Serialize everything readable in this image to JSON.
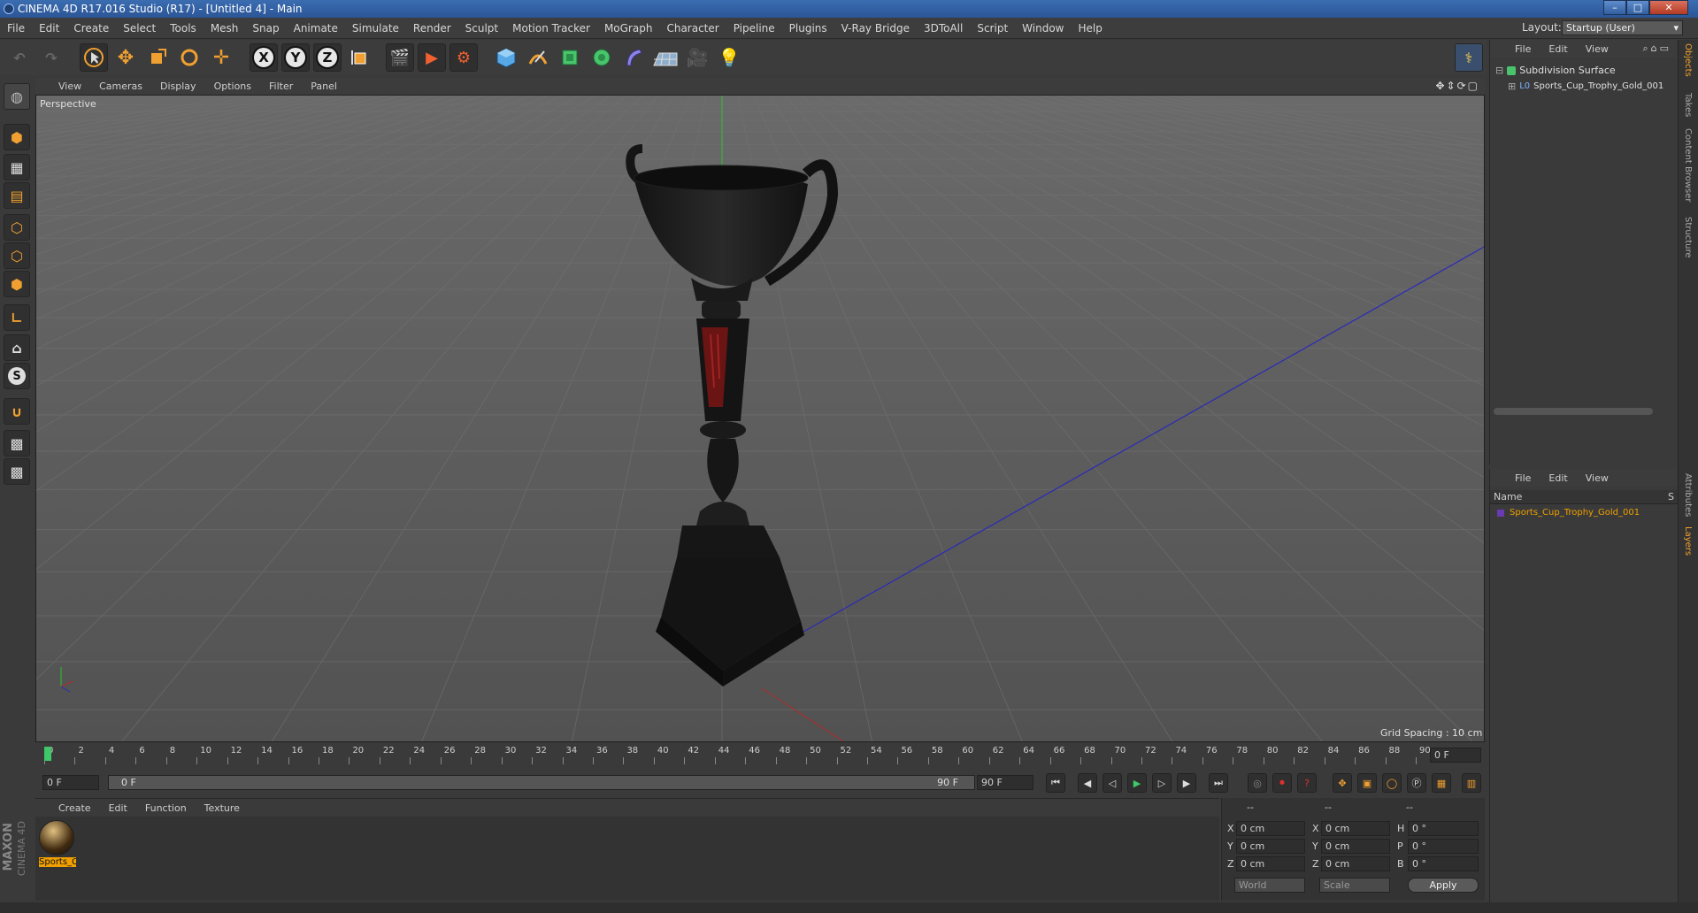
{
  "window": {
    "title": "CINEMA 4D R17.016 Studio (R17) - [Untitled 4] - Main",
    "controls": [
      "–",
      "□",
      "✕"
    ]
  },
  "menubar": [
    "File",
    "Edit",
    "Create",
    "Select",
    "Tools",
    "Mesh",
    "Snap",
    "Animate",
    "Simulate",
    "Render",
    "Sculpt",
    "Motion Tracker",
    "MoGraph",
    "Character",
    "Pipeline",
    "Plugins",
    "V-Ray Bridge",
    "3DToAll",
    "Script",
    "Window",
    "Help"
  ],
  "layout": {
    "label": "Layout:",
    "value": "Startup (User)"
  },
  "toolbar": {
    "axis_x": "X",
    "axis_y": "Y",
    "axis_z": "Z"
  },
  "left_tools": {
    "snap_label": "S"
  },
  "viewport": {
    "menu": [
      "View",
      "Cameras",
      "Display",
      "Options",
      "Filter",
      "Panel"
    ],
    "label": "Perspective",
    "grid_spacing": "Grid Spacing : 10 cm"
  },
  "timeline": {
    "ticks": [
      "0",
      "2",
      "4",
      "6",
      "8",
      "10",
      "12",
      "14",
      "16",
      "18",
      "20",
      "22",
      "24",
      "26",
      "28",
      "30",
      "32",
      "34",
      "36",
      "38",
      "40",
      "42",
      "44",
      "46",
      "48",
      "50",
      "52",
      "54",
      "56",
      "58",
      "60",
      "62",
      "64",
      "66",
      "68",
      "70",
      "72",
      "74",
      "76",
      "78",
      "80",
      "82",
      "84",
      "86",
      "88",
      "90"
    ],
    "current_frame": "0 F"
  },
  "transport": {
    "start_field": "0 F",
    "range_start": "0 F",
    "range_end": "90 F",
    "end_field": "90 F"
  },
  "material_panel": {
    "menu": [
      "Create",
      "Edit",
      "Function",
      "Texture"
    ],
    "material_name": "Sports_C",
    "brand": "MAXON",
    "brand_sub": "CINEMA 4D"
  },
  "coord_panel": {
    "header": [
      "--",
      "--",
      "--"
    ],
    "rows": [
      {
        "a": "X",
        "av": "0 cm",
        "b": "X",
        "bv": "0 cm",
        "c": "H",
        "cv": "0 °"
      },
      {
        "a": "Y",
        "av": "0 cm",
        "b": "Y",
        "bv": "0 cm",
        "c": "P",
        "cv": "0 °"
      },
      {
        "a": "Z",
        "av": "0 cm",
        "b": "Z",
        "bv": "0 cm",
        "c": "B",
        "cv": "0 °"
      }
    ],
    "world": "World",
    "scale": "Scale",
    "apply": "Apply"
  },
  "objects_panel": {
    "menu": [
      "File",
      "Edit",
      "View"
    ],
    "items": [
      "Subdivision Surface",
      "Sports_Cup_Trophy_Gold_001"
    ]
  },
  "layers_panel": {
    "menu": [
      "File",
      "Edit",
      "View"
    ],
    "col_name": "Name",
    "col_s": "S",
    "items": [
      "Sports_Cup_Trophy_Gold_001"
    ]
  },
  "side_tabs": [
    "Objects",
    "Takes",
    "Content Browser",
    "Structure",
    "Attributes",
    "Layers"
  ],
  "colors": {
    "accent": "#f0a030",
    "title_blue": "#2b5596",
    "viewport_bg": "#5c5c5c",
    "layer_orange": "#f0a000"
  }
}
